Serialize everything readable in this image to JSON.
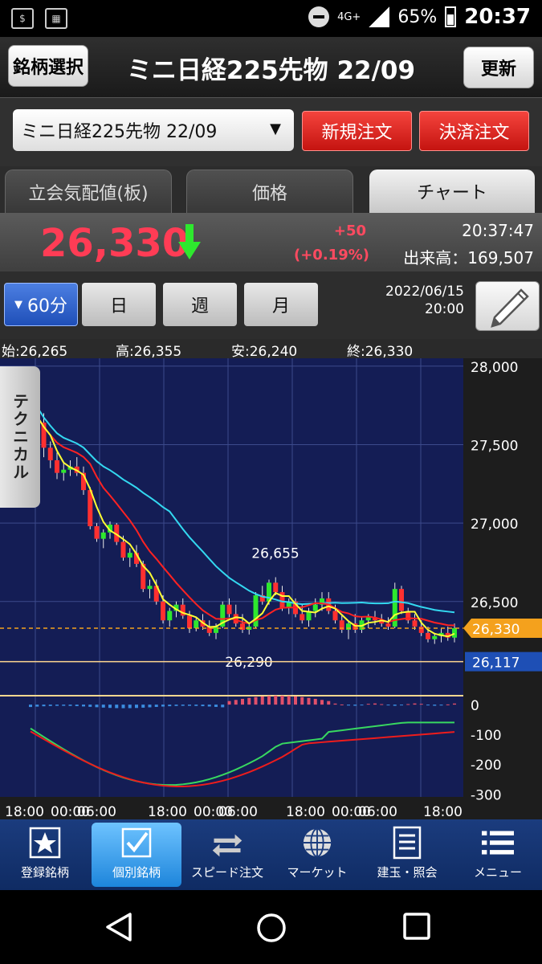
{
  "statusbar": {
    "network": "4G+",
    "battery": "65%",
    "time": "20:37"
  },
  "header": {
    "select_symbol_label": "銘柄選択",
    "title": "ミニ日経225先物 22/09",
    "refresh_label": "更新"
  },
  "symbol_row": {
    "selected_symbol": "ミニ日経225先物 22/09",
    "new_order_label": "新規注文",
    "settle_order_label": "決済注文"
  },
  "tabs": [
    {
      "label": "立会気配値(板)"
    },
    {
      "label": "価格"
    },
    {
      "label": "チャート"
    }
  ],
  "price_panel": {
    "price": "26,330",
    "change": "+50",
    "change_pct": "(+0.19%)",
    "time": "20:37:47",
    "volume_text": "出来高：169,507"
  },
  "periods": {
    "selected": "60分",
    "day": "日",
    "week": "週",
    "month": "月"
  },
  "chart_datetime": {
    "date": "2022/06/15",
    "time": "20:00"
  },
  "ohlc": {
    "open": "始:26,265",
    "high": "高:26,355",
    "low": "安:26,240",
    "close": "終:26,330"
  },
  "technical_tab_label": "テクニカル",
  "colors": {
    "up_candle": "#2ee82e",
    "down_candle": "#ff3030",
    "ma_short": "#ffff33",
    "ma_mid": "#ff2222",
    "ma_long": "#33d8f0",
    "chart_bg": "#141d55",
    "price_color": "#ff3c55",
    "current_price_tag": "#f4a11d",
    "secondary_price_tag": "#1e4fb5"
  },
  "chart_data": {
    "type": "candlestick",
    "interval": "60分",
    "x_tick_labels": [
      "18:00",
      "00:00",
      "06:00",
      "18:00",
      "00:00",
      "06:00",
      "18:00",
      "00:00",
      "06:00",
      "18:00"
    ],
    "y_tick_labels": [
      "28,000",
      "27,500",
      "27,000",
      "26,500"
    ],
    "ylim": [
      25900,
      28050
    ],
    "annotations": [
      {
        "text": "26,655",
        "value": 26655,
        "index": 37
      },
      {
        "text": "26,290",
        "value": 26290,
        "index": 33
      }
    ],
    "current_price_tag": {
      "text": "26,330",
      "value": 26330
    },
    "secondary_price_tag": {
      "text": "26,117",
      "value": 26117
    },
    "candles": [
      [
        27700,
        27760,
        27650,
        27720
      ],
      [
        27720,
        27780,
        27600,
        27640
      ],
      [
        27640,
        27700,
        27420,
        27480
      ],
      [
        27480,
        27520,
        27350,
        27400
      ],
      [
        27400,
        27450,
        27280,
        27320
      ],
      [
        27320,
        27380,
        27270,
        27340
      ],
      [
        27340,
        27400,
        27300,
        27360
      ],
      [
        27360,
        27420,
        27300,
        27320
      ],
      [
        27320,
        27360,
        27180,
        27210
      ],
      [
        27210,
        27230,
        26960,
        26980
      ],
      [
        26980,
        27000,
        26880,
        26900
      ],
      [
        26900,
        26960,
        26840,
        26940
      ],
      [
        26940,
        27010,
        26900,
        26990
      ],
      [
        26990,
        27000,
        26860,
        26880
      ],
      [
        26880,
        26920,
        26760,
        26780
      ],
      [
        26780,
        26840,
        26720,
        26810
      ],
      [
        26810,
        26860,
        26720,
        26740
      ],
      [
        26740,
        26760,
        26560,
        26580
      ],
      [
        26580,
        26640,
        26520,
        26600
      ],
      [
        26600,
        26640,
        26480,
        26500
      ],
      [
        26500,
        26540,
        26360,
        26380
      ],
      [
        26380,
        26460,
        26340,
        26440
      ],
      [
        26440,
        26500,
        26400,
        26480
      ],
      [
        26480,
        26520,
        26390,
        26410
      ],
      [
        26410,
        26440,
        26300,
        26330
      ],
      [
        26330,
        26400,
        26310,
        26380
      ],
      [
        26380,
        26420,
        26320,
        26340
      ],
      [
        26340,
        26380,
        26280,
        26300
      ],
      [
        26300,
        26360,
        26260,
        26340
      ],
      [
        26340,
        26500,
        26330,
        26480
      ],
      [
        26480,
        26520,
        26400,
        26420
      ],
      [
        26420,
        26480,
        26340,
        26360
      ],
      [
        26360,
        26420,
        26300,
        26320
      ],
      [
        26320,
        26360,
        26290,
        26340
      ],
      [
        26340,
        26560,
        26330,
        26540
      ],
      [
        26540,
        26600,
        26480,
        26500
      ],
      [
        26500,
        26640,
        26480,
        26620
      ],
      [
        26620,
        26655,
        26540,
        26560
      ],
      [
        26560,
        26600,
        26440,
        26460
      ],
      [
        26460,
        26520,
        26420,
        26500
      ],
      [
        26500,
        26520,
        26400,
        26420
      ],
      [
        26420,
        26480,
        26360,
        26380
      ],
      [
        26380,
        26460,
        26340,
        26440
      ],
      [
        26440,
        26520,
        26400,
        26480
      ],
      [
        26480,
        26560,
        26440,
        26520
      ],
      [
        26520,
        26560,
        26420,
        26440
      ],
      [
        26440,
        26480,
        26360,
        26380
      ],
      [
        26380,
        26420,
        26300,
        26320
      ],
      [
        26320,
        26380,
        26260,
        26360
      ],
      [
        26360,
        26420,
        26300,
        26320
      ],
      [
        26320,
        26400,
        26300,
        26380
      ],
      [
        26380,
        26420,
        26330,
        26400
      ],
      [
        26400,
        26440,
        26350,
        26380
      ],
      [
        26380,
        26420,
        26340,
        26360
      ],
      [
        26360,
        26400,
        26320,
        26340
      ],
      [
        26340,
        26620,
        26330,
        26580
      ],
      [
        26580,
        26600,
        26420,
        26440
      ],
      [
        26440,
        26460,
        26360,
        26380
      ],
      [
        26380,
        26420,
        26320,
        26340
      ],
      [
        26340,
        26380,
        26280,
        26300
      ],
      [
        26300,
        26340,
        26240,
        26260
      ],
      [
        26260,
        26300,
        26230,
        26280
      ],
      [
        26280,
        26330,
        26240,
        26300
      ],
      [
        26300,
        26340,
        26250,
        26270
      ],
      [
        26270,
        26360,
        26240,
        26330
      ]
    ],
    "indicator_panel": {
      "y_tick_labels": [
        "0",
        "-100",
        "-200",
        "-300"
      ],
      "ylim": [
        -310,
        30
      ]
    }
  },
  "bottom_nav": [
    {
      "label": "登録銘柄"
    },
    {
      "label": "個別銘柄"
    },
    {
      "label": "スピード注文"
    },
    {
      "label": "マーケット"
    },
    {
      "label": "建玉・照会"
    },
    {
      "label": "メニュー"
    }
  ]
}
